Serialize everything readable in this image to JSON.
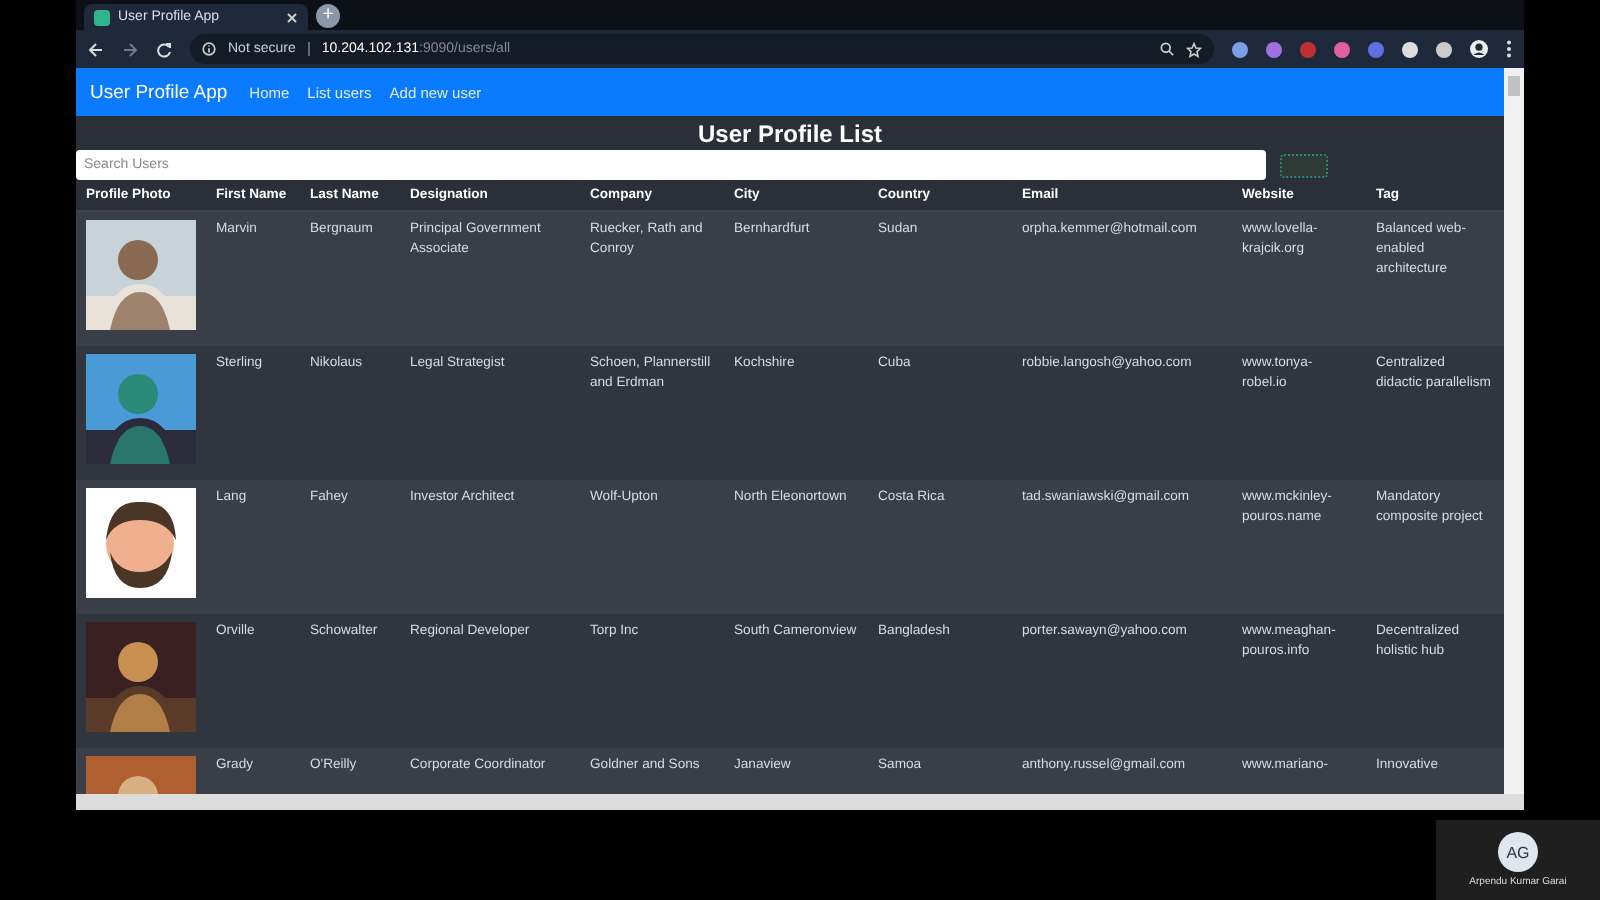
{
  "browser": {
    "tab_title": "User Profile App",
    "new_tab": "+",
    "security": "Not secure",
    "url_host": "10.204.102.131",
    "url_path": ":9090/users/all"
  },
  "navbar": {
    "brand": "User Profile App",
    "links": [
      "Home",
      "List users",
      "Add new user"
    ]
  },
  "heading": "User Profile List",
  "search": {
    "placeholder": "Search Users"
  },
  "table": {
    "columns": [
      "Profile Photo",
      "First Name",
      "Last Name",
      "Designation",
      "Company",
      "City",
      "Country",
      "Email",
      "Website",
      "Tag"
    ],
    "rows": [
      {
        "cells": [
          {
            "kind": "picture"
          },
          "Marvin",
          "Bergnaum",
          "Principal Government Associate",
          "Ruecker, Rath and Conroy",
          "Bernhardfurt",
          "Sudan",
          "orpha.kemmer@hotmail.com",
          "www.lovella-krajcik.org",
          "Balanced web-enabled architecture"
        ]
      },
      {
        "cells": [
          {
            "kind": "picture"
          },
          "Sterling",
          "Nikolaus",
          "Legal Strategist",
          "Schoen, Plannerstill and Erdman",
          "Kochshire",
          "Cuba",
          "robbie.langosh@yahoo.com",
          "www.tonya-robel.io",
          "Centralized didactic parallelism"
        ]
      },
      {
        "cells": [
          {
            "kind": "picture"
          },
          "Lang",
          "Fahey",
          "Investor Architect",
          "Wolf-Upton",
          "North Eleonortown",
          "Costa Rica",
          "tad.swaniawski@gmail.com",
          "www.mckinley-pouros.name",
          "Mandatory composite project"
        ]
      },
      {
        "cells": [
          {
            "kind": "picture"
          },
          "Orville",
          "Schowalter",
          "Regional Developer",
          "Torp Inc",
          "South Cameronview",
          "Bangladesh",
          "porter.sawayn@yahoo.com",
          "www.meaghan-pouros.info",
          "Decentralized holistic hub"
        ]
      },
      {
        "cells": [
          {
            "kind": "picture"
          },
          "Grady",
          "O'Reilly",
          "Corporate Coordinator",
          "Goldner and Sons",
          "Janaview",
          "Samoa",
          "anthony.russel@gmail.com",
          "www.mariano-",
          "Innovative"
        ]
      }
    ]
  },
  "participant": {
    "initials": "AG",
    "name": "Arpendu Kumar Garai"
  }
}
